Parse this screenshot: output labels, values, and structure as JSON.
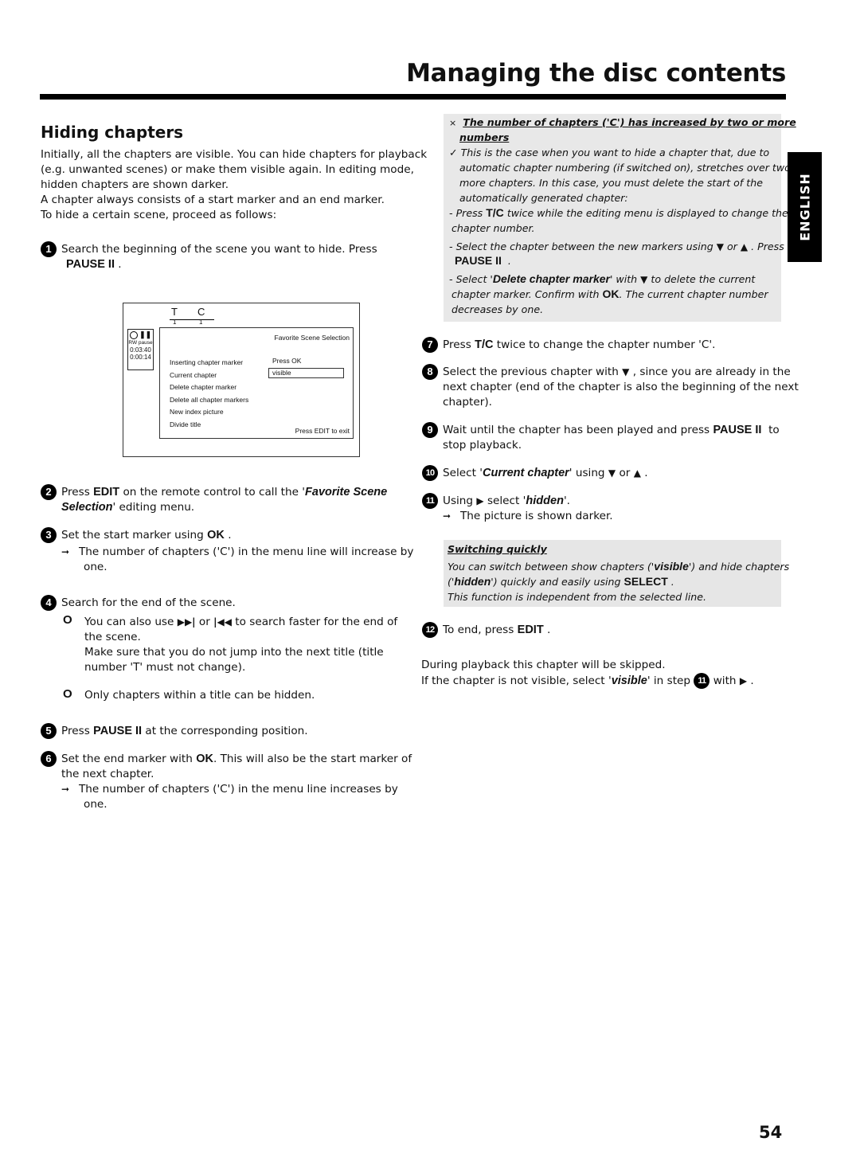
{
  "header": {
    "title": "Managing the disc contents"
  },
  "section": {
    "heading": "Hiding chapters",
    "intro": [
      "Initially, all the chapters are visible. You can hide chapters for playback",
      "(e.g. unwanted scenes) or make them visible again. In editing mode,",
      "hidden chapters are shown darker.",
      "A chapter always consists of a start marker and an end marker.",
      "To hide a certain scene, proceed as follows:"
    ]
  },
  "keys": {
    "pause": "PAUSE II",
    "edit": "EDIT",
    "ok": "OK",
    "tc": "T/C",
    "select": "SELECT"
  },
  "steps": {
    "s1": {
      "num": "1",
      "text": "Search the beginning of the scene you want to hide. Press"
    },
    "s2": {
      "num": "2",
      "pre": "Press",
      "mid": "on the remote control to call the '",
      "em1": "Favorite Scene",
      "em2": "Selection",
      "post": "' editing menu."
    },
    "s3": {
      "num": "3",
      "pre": "Set the start marker using",
      "result": "The number of chapters ('C') in the menu line will increase by",
      "result2": "one."
    },
    "s4": {
      "num": "4",
      "text": "Search for the end of the scene.",
      "tip1_pre": "You can also use",
      "tip1_or": "or",
      "tip1_post": "to search faster for the end of",
      "tip1_l2": "the scene.",
      "tip1_l3": "Make sure that you do not jump into the next title (title",
      "tip1_l4": "number 'T' must not change).",
      "tip2": "Only chapters within a title can be hidden."
    },
    "s5": {
      "num": "5",
      "pre": "Press",
      "post": "at the corresponding position."
    },
    "s6": {
      "num": "6",
      "pre": "Set the end marker with",
      "post": ". This will also be the start marker of",
      "l2": "the next chapter.",
      "result": "The number of chapters ('C') in the menu line increases by",
      "result2": "one."
    },
    "s7": {
      "num": "7",
      "pre": "Press",
      "post": "twice to change the chapter number 'C'."
    },
    "s8": {
      "num": "8",
      "pre": "Select the previous chapter with",
      "post": ", since you are already in the",
      "l2": "next chapter (end of the chapter is also the beginning of the next",
      "l3": "chapter)."
    },
    "s9": {
      "num": "9",
      "pre": "Wait until the chapter has been played and press",
      "post": "to",
      "l2": "stop playback."
    },
    "s10": {
      "num": "10",
      "pre": "Select '",
      "em": "Current chapter",
      "mid": "' using",
      "or": "or"
    },
    "s11": {
      "num": "11",
      "pre": "Using",
      "mid": "select '",
      "em": "hidden",
      "post": "'.",
      "result": "The picture is shown darker."
    },
    "s12": {
      "num": "12",
      "pre": "To end, press"
    }
  },
  "osd": {
    "t_label": "T",
    "c_label": "C",
    "t_value": "1",
    "c_value": "1",
    "status_mode": "RW",
    "status_state": "pause",
    "time_total": "0:03:40",
    "time_current": "0:00:14",
    "menu_title": "Favorite Scene Selection",
    "menu_items": [
      "Inserting chapter marker",
      "Current chapter",
      "Delete chapter marker",
      "Delete all chapter markers",
      "New index picture",
      "Divide title"
    ],
    "value_press_ok": "Press OK",
    "value_current_chapter": "visible",
    "exit_hint": "Press EDIT to exit"
  },
  "troubleshoot": {
    "problem": "The number of chapters ('C') has increased by two or more",
    "problem2": "numbers",
    "solution": [
      "This is the case when you want to hide a chapter that, due to",
      "automatic chapter numbering (if switched on), stretches over two or",
      "more chapters. In this case, you must delete the start of the",
      "automatically generated chapter:"
    ],
    "a1_pre": "Press",
    "a1_post": "twice while the editing menu is displayed to change the",
    "a1_l2": "chapter number.",
    "a2_pre": "Select the chapter between the new markers using",
    "a2_or": "or",
    "a2_post": ". Press",
    "a3_pre": "Select '",
    "a3_em": "Delete chapter marker",
    "a3_mid": "' with",
    "a3_post": "to delete the current",
    "a3_l2_pre": "chapter marker. Confirm with",
    "a3_l2_post": ". The current chapter number",
    "a3_l3": "decreases by one."
  },
  "switching": {
    "title": "Switching quickly",
    "l1_pre": "You can switch between show chapters ('",
    "l1_em": "visible",
    "l1_post": "') and hide chapters",
    "l2_pre": "('",
    "l2_em": "hidden",
    "l2_mid": "') quickly and easily using",
    "l3": "This function is independent from the selected line."
  },
  "footer_text": {
    "l1": "During playback this chapter will be skipped.",
    "l2_pre": "If the chapter is not visible, select '",
    "l2_em": "visible",
    "l2_mid": "' in step",
    "l2_step": "11",
    "l2_with": "with"
  },
  "language_tab": "ENGLISH",
  "page_number": "54"
}
